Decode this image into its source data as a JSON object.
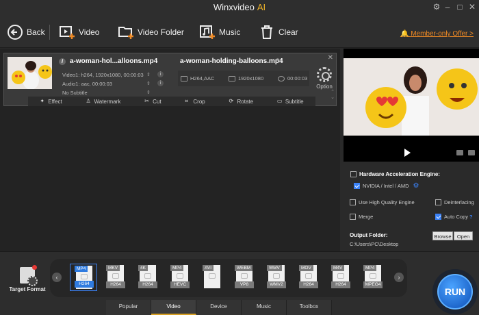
{
  "window": {
    "title": "Winxvideo",
    "title_accent": "AI"
  },
  "toolbar": {
    "back": "Back",
    "video": "Video",
    "video_folder": "Video Folder",
    "music": "Music",
    "clear": "Clear",
    "member_offer": "Member-only Offer >"
  },
  "file": {
    "source_name": "a-woman-hol...alloons.mp4",
    "video_track": "Video1: h264, 1920x1080, 00:00:03",
    "audio_track": "Audio1: aac, 00:00:03",
    "subtitle": "No Subtitle",
    "output_name": "a-woman-holding-balloons.mp4",
    "output_codec": "H264,AAC",
    "output_resolution": "1920x1080",
    "output_duration": "00:00:03",
    "option": "Option"
  },
  "edit_tools": [
    "Effect",
    "Watermark",
    "Cut",
    "Crop",
    "Rotate",
    "Subtitle"
  ],
  "settings": {
    "hw_accel": "Hardware Acceleration Engine:",
    "hw_option": "NVIDIA / Intel / AMD",
    "high_quality": "Use High Quality Engine",
    "deinterlacing": "Deinterlacing",
    "merge": "Merge",
    "auto_copy": "Auto Copy",
    "auto_copy_help": "?",
    "output_folder_label": "Output Folder:",
    "output_folder_path": "C:\\Users\\PC\\Desktop",
    "browse": "Browse",
    "open": "Open"
  },
  "target_format": "Target Format",
  "formats": [
    {
      "top": "MP4",
      "bottom": "H264"
    },
    {
      "top": "MKV",
      "bottom": "H264"
    },
    {
      "top": "4K",
      "bottom": "H264"
    },
    {
      "top": "MP4",
      "bottom": "HEVC"
    },
    {
      "top": "AVI",
      "bottom": ""
    },
    {
      "top": "WEBM",
      "bottom": "VP8"
    },
    {
      "top": "WMV",
      "bottom": "WMV2"
    },
    {
      "top": "MOV",
      "bottom": "H264"
    },
    {
      "top": "M4V",
      "bottom": "H264"
    },
    {
      "top": "MP4",
      "bottom": "MPEG4"
    }
  ],
  "tabs": [
    "Popular",
    "Video",
    "Device",
    "Music",
    "Toolbox"
  ],
  "run": "RUN",
  "colors": {
    "accent": "#3b82f6",
    "tab_active": "#d8a023",
    "member": "#f08a24"
  }
}
